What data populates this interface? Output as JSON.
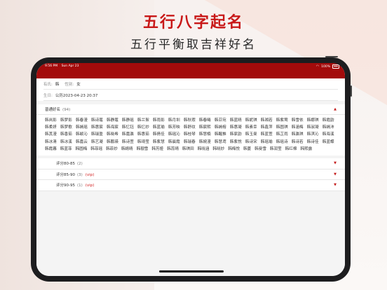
{
  "header": {
    "title": "五行八字起名",
    "subtitle": "五行平衡取吉祥好名"
  },
  "status_bar": {
    "time": "9:56 PM",
    "date": "Sun Apr 23",
    "battery": "100%"
  },
  "info": {
    "surname_label": "有氏:",
    "surname": "韩",
    "gender_label": "性别:",
    "gender": "女",
    "birth_label": "生日:",
    "birth": "公历2023-04-23 20:37"
  },
  "section": {
    "title": "普通好名",
    "count": "(94)",
    "names": [
      "韩岚影",
      "韩梦影",
      "韩春漫",
      "韩诗蔻",
      "韩静蔻",
      "韩静瑶",
      "韩兰絮",
      "韩雨影",
      "韩月圳",
      "韩秋瑕",
      "韩春曦",
      "韩芬宛",
      "韩蓝晴",
      "韩妮琪",
      "韩湘若",
      "韩紫莺",
      "韩雪依",
      "韩娜琪",
      "韩霞韵",
      "韩柔妍",
      "韩梦歌",
      "韩嫣瑶",
      "韩惠宸",
      "韩海宸",
      "韩忆钰",
      "韩忆妙",
      "韩蓝瑜",
      "韩芳映",
      "韩舒纹",
      "韩宸熙",
      "韩嫣榕",
      "韩惠凝",
      "韩素幸",
      "韩鑫萍",
      "韩圆琪",
      "韩涵梅",
      "韩淑凝",
      "韩嫣沛",
      "韩其漫",
      "韩香茹",
      "韩颖沁",
      "韩瑞盈",
      "韩晓希",
      "韩嘉瀛",
      "韩惠茹",
      "韩倩佳",
      "韩瑶沁",
      "韩桂琴",
      "韩慧楠",
      "韩醒推",
      "韩家韵",
      "韩玉曼",
      "韩蓝萱",
      "韩芷雨",
      "韩瀛琪",
      "韩淇沁",
      "韩海溪",
      "韩冰清",
      "韩冰溪",
      "韩嘉云",
      "韩艺凝",
      "韩鹏瑛",
      "韩诗萱",
      "韩琦莹",
      "韩紫慧",
      "韩晨霞",
      "韩瑞春",
      "韩婉漫",
      "韩慧鸢",
      "韩紫悦",
      "韩诗宋",
      "韩瑶瑜",
      "韩瑶诗",
      "韩诗若",
      "韩诗佳",
      "韩蓝蝶",
      "韩霞暮",
      "韩蓝菲",
      "韩圆梅",
      "韩菲瑶",
      "韩菲妙",
      "韩婧晴",
      "韩靓雪",
      "韩芳娅",
      "韩蕊晴",
      "韩琪田",
      "韩晓涵",
      "韩晓妙",
      "韩梅悦",
      "韩蔓",
      "韩曼雪",
      "韩润莹",
      "韩红棉",
      "韩熙露"
    ]
  },
  "groups": [
    {
      "label": "评分80-85",
      "count": "(2)",
      "vip": ""
    },
    {
      "label": "评分85-90",
      "count": "(3)",
      "vip": "(vip)"
    },
    {
      "label": "评分90-95",
      "count": "(1)",
      "vip": "(vip)"
    }
  ],
  "colors": {
    "accent": "#c81818",
    "statusbar": "#a30b0b"
  },
  "icons": {
    "expanded": "chevron-up-icon",
    "collapsed": "chevron-down-icon"
  }
}
